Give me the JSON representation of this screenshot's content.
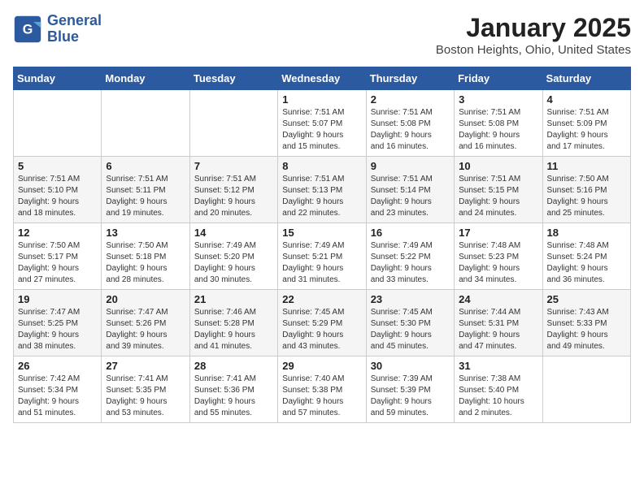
{
  "header": {
    "logo_line1": "General",
    "logo_line2": "Blue",
    "month": "January 2025",
    "location": "Boston Heights, Ohio, United States"
  },
  "weekdays": [
    "Sunday",
    "Monday",
    "Tuesday",
    "Wednesday",
    "Thursday",
    "Friday",
    "Saturday"
  ],
  "weeks": [
    [
      {
        "day": "",
        "info": ""
      },
      {
        "day": "",
        "info": ""
      },
      {
        "day": "",
        "info": ""
      },
      {
        "day": "1",
        "info": "Sunrise: 7:51 AM\nSunset: 5:07 PM\nDaylight: 9 hours\nand 15 minutes."
      },
      {
        "day": "2",
        "info": "Sunrise: 7:51 AM\nSunset: 5:08 PM\nDaylight: 9 hours\nand 16 minutes."
      },
      {
        "day": "3",
        "info": "Sunrise: 7:51 AM\nSunset: 5:08 PM\nDaylight: 9 hours\nand 16 minutes."
      },
      {
        "day": "4",
        "info": "Sunrise: 7:51 AM\nSunset: 5:09 PM\nDaylight: 9 hours\nand 17 minutes."
      }
    ],
    [
      {
        "day": "5",
        "info": "Sunrise: 7:51 AM\nSunset: 5:10 PM\nDaylight: 9 hours\nand 18 minutes."
      },
      {
        "day": "6",
        "info": "Sunrise: 7:51 AM\nSunset: 5:11 PM\nDaylight: 9 hours\nand 19 minutes."
      },
      {
        "day": "7",
        "info": "Sunrise: 7:51 AM\nSunset: 5:12 PM\nDaylight: 9 hours\nand 20 minutes."
      },
      {
        "day": "8",
        "info": "Sunrise: 7:51 AM\nSunset: 5:13 PM\nDaylight: 9 hours\nand 22 minutes."
      },
      {
        "day": "9",
        "info": "Sunrise: 7:51 AM\nSunset: 5:14 PM\nDaylight: 9 hours\nand 23 minutes."
      },
      {
        "day": "10",
        "info": "Sunrise: 7:51 AM\nSunset: 5:15 PM\nDaylight: 9 hours\nand 24 minutes."
      },
      {
        "day": "11",
        "info": "Sunrise: 7:50 AM\nSunset: 5:16 PM\nDaylight: 9 hours\nand 25 minutes."
      }
    ],
    [
      {
        "day": "12",
        "info": "Sunrise: 7:50 AM\nSunset: 5:17 PM\nDaylight: 9 hours\nand 27 minutes."
      },
      {
        "day": "13",
        "info": "Sunrise: 7:50 AM\nSunset: 5:18 PM\nDaylight: 9 hours\nand 28 minutes."
      },
      {
        "day": "14",
        "info": "Sunrise: 7:49 AM\nSunset: 5:20 PM\nDaylight: 9 hours\nand 30 minutes."
      },
      {
        "day": "15",
        "info": "Sunrise: 7:49 AM\nSunset: 5:21 PM\nDaylight: 9 hours\nand 31 minutes."
      },
      {
        "day": "16",
        "info": "Sunrise: 7:49 AM\nSunset: 5:22 PM\nDaylight: 9 hours\nand 33 minutes."
      },
      {
        "day": "17",
        "info": "Sunrise: 7:48 AM\nSunset: 5:23 PM\nDaylight: 9 hours\nand 34 minutes."
      },
      {
        "day": "18",
        "info": "Sunrise: 7:48 AM\nSunset: 5:24 PM\nDaylight: 9 hours\nand 36 minutes."
      }
    ],
    [
      {
        "day": "19",
        "info": "Sunrise: 7:47 AM\nSunset: 5:25 PM\nDaylight: 9 hours\nand 38 minutes."
      },
      {
        "day": "20",
        "info": "Sunrise: 7:47 AM\nSunset: 5:26 PM\nDaylight: 9 hours\nand 39 minutes."
      },
      {
        "day": "21",
        "info": "Sunrise: 7:46 AM\nSunset: 5:28 PM\nDaylight: 9 hours\nand 41 minutes."
      },
      {
        "day": "22",
        "info": "Sunrise: 7:45 AM\nSunset: 5:29 PM\nDaylight: 9 hours\nand 43 minutes."
      },
      {
        "day": "23",
        "info": "Sunrise: 7:45 AM\nSunset: 5:30 PM\nDaylight: 9 hours\nand 45 minutes."
      },
      {
        "day": "24",
        "info": "Sunrise: 7:44 AM\nSunset: 5:31 PM\nDaylight: 9 hours\nand 47 minutes."
      },
      {
        "day": "25",
        "info": "Sunrise: 7:43 AM\nSunset: 5:33 PM\nDaylight: 9 hours\nand 49 minutes."
      }
    ],
    [
      {
        "day": "26",
        "info": "Sunrise: 7:42 AM\nSunset: 5:34 PM\nDaylight: 9 hours\nand 51 minutes."
      },
      {
        "day": "27",
        "info": "Sunrise: 7:41 AM\nSunset: 5:35 PM\nDaylight: 9 hours\nand 53 minutes."
      },
      {
        "day": "28",
        "info": "Sunrise: 7:41 AM\nSunset: 5:36 PM\nDaylight: 9 hours\nand 55 minutes."
      },
      {
        "day": "29",
        "info": "Sunrise: 7:40 AM\nSunset: 5:38 PM\nDaylight: 9 hours\nand 57 minutes."
      },
      {
        "day": "30",
        "info": "Sunrise: 7:39 AM\nSunset: 5:39 PM\nDaylight: 9 hours\nand 59 minutes."
      },
      {
        "day": "31",
        "info": "Sunrise: 7:38 AM\nSunset: 5:40 PM\nDaylight: 10 hours\nand 2 minutes."
      },
      {
        "day": "",
        "info": ""
      }
    ]
  ]
}
